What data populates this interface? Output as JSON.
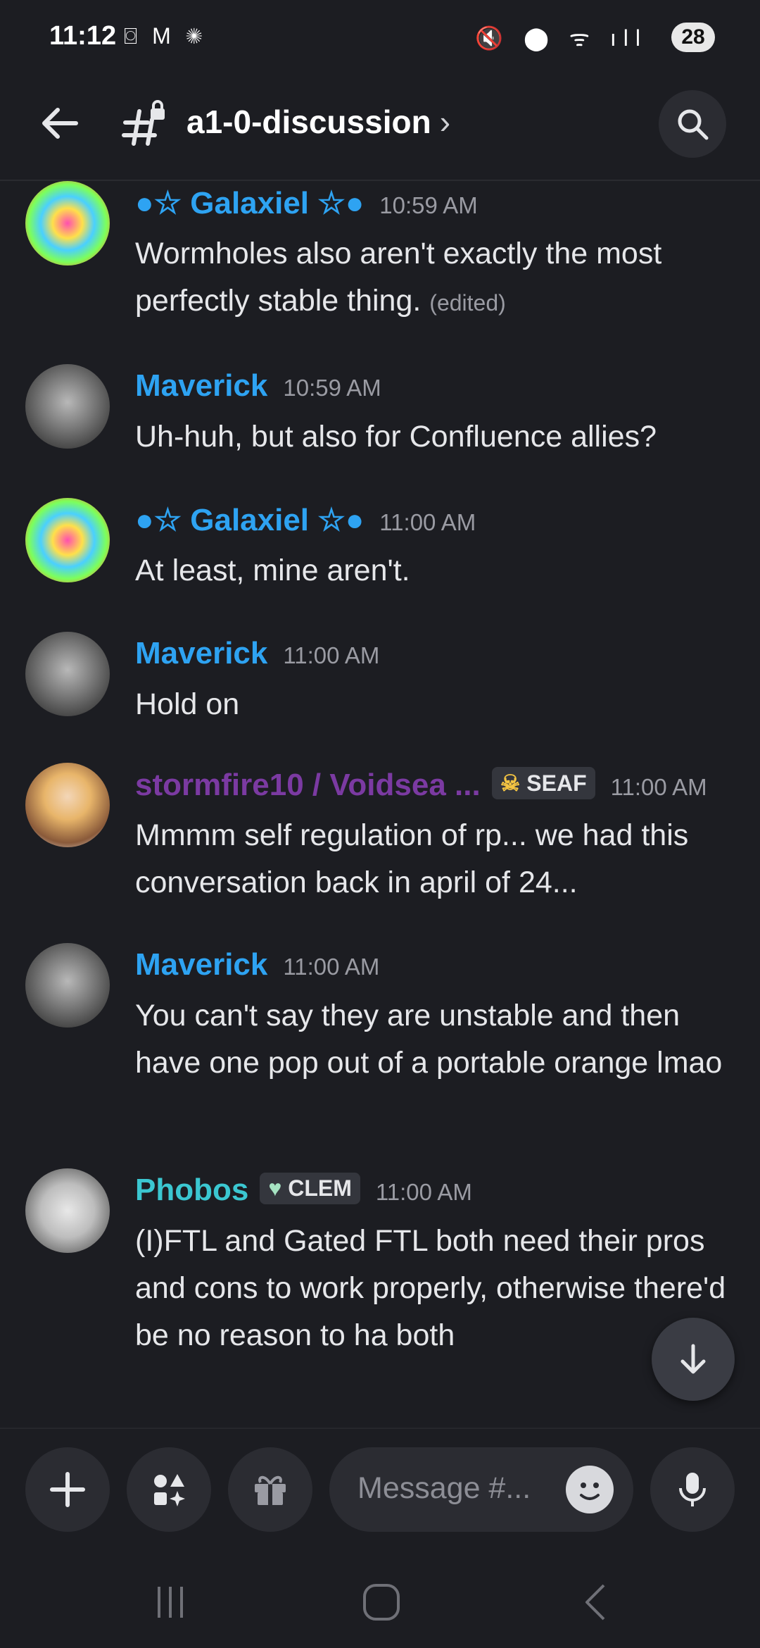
{
  "status_bar": {
    "time": "11:12",
    "left_icons": "⌼ M ✺",
    "right_icons": "🔇 ⬤ ᯤ ıll",
    "battery": "28"
  },
  "header": {
    "channel_name": "a1-0-discussion",
    "chevron": "›"
  },
  "messages": [
    {
      "author": "●☆ Galaxiel ☆●",
      "time": "10:59 AM",
      "text": "Wormholes also aren't exactly the most perfectly stable thing.",
      "edited": "(edited)",
      "avatar": "spiral"
    },
    {
      "author": "Maverick",
      "time": "10:59 AM",
      "text": "Uh-huh, but also for Confluence allies?",
      "avatar": "soldier"
    },
    {
      "author": "●☆ Galaxiel ☆●",
      "time": "11:00 AM",
      "text": "At least, mine aren't.",
      "avatar": "spiral"
    },
    {
      "author": "Maverick",
      "time": "11:00 AM",
      "text": "Hold on",
      "avatar": "soldier"
    },
    {
      "author": "stormfire10 / Voidsea ...",
      "badge": "SEAF",
      "badge_icon": "skull-icon",
      "time": "11:00 AM",
      "text": "Mmmm self regulation of rp... we had this conversation back in april of 24...",
      "avatar": "anime"
    },
    {
      "author": "Maverick",
      "time": "11:00 AM",
      "text": "You can't say they are unstable and then have one pop out of a portable orange lmao",
      "avatar": "soldier"
    },
    {
      "author": "Phobos",
      "badge": "CLEM",
      "badge_icon": "heart-icon",
      "time": "11:00 AM",
      "text": "(I)FTL and Gated FTL both need their pros and cons to work properly, otherwise there'd be no reason to ha both",
      "avatar": "robot"
    }
  ],
  "composer": {
    "placeholder": "Message #..."
  },
  "colors": {
    "background": "#1c1d22",
    "username_blue": "#2ea3f2",
    "username_purple": "#7b3aa2",
    "username_teal": "#3bc7d1"
  }
}
